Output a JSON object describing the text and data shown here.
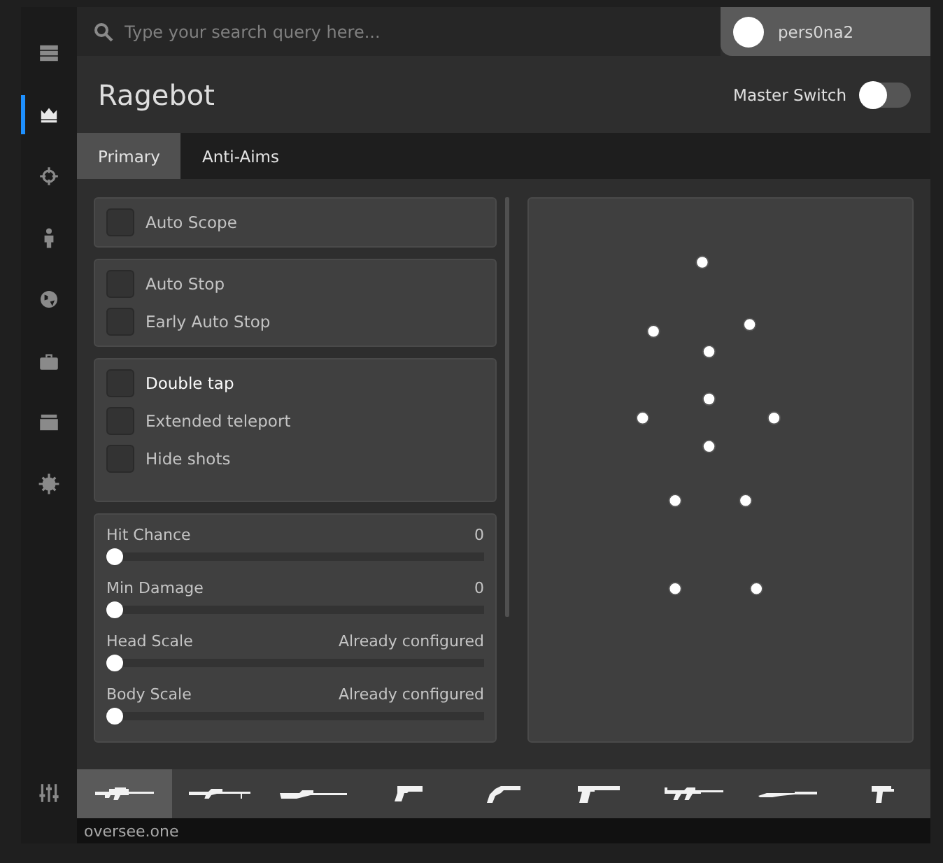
{
  "search": {
    "placeholder": "Type your search query here..."
  },
  "user": {
    "name": "pers0na2"
  },
  "sidebar": {
    "items": [
      {
        "kind": "server",
        "selected": false
      },
      {
        "kind": "crown",
        "selected": true
      },
      {
        "kind": "crosshair",
        "selected": false
      },
      {
        "kind": "person",
        "selected": false
      },
      {
        "kind": "globe",
        "selected": false
      },
      {
        "kind": "briefcase",
        "selected": false
      },
      {
        "kind": "box",
        "selected": false
      },
      {
        "kind": "gear",
        "selected": false
      }
    ],
    "bottom_item": {
      "kind": "sliders",
      "selected": false
    }
  },
  "page": {
    "title": "Ragebot",
    "master_switch": {
      "label": "Master Switch",
      "on": false
    }
  },
  "tabs": [
    {
      "label": "Primary",
      "selected": true
    },
    {
      "label": "Anti-Aims",
      "selected": false
    }
  ],
  "groups": [
    {
      "kind": "checkboxes",
      "items": [
        {
          "label": "Auto Scope",
          "checked": false,
          "highlighted": false
        }
      ]
    },
    {
      "kind": "checkboxes",
      "items": [
        {
          "label": "Auto Stop",
          "checked": false,
          "highlighted": false
        },
        {
          "label": "Early Auto Stop",
          "checked": false,
          "highlighted": false
        }
      ]
    },
    {
      "kind": "checkboxes",
      "items": [
        {
          "label": "Double tap",
          "checked": false,
          "highlighted": true
        },
        {
          "label": "Extended teleport",
          "checked": false,
          "highlighted": false
        },
        {
          "label": "Hide shots",
          "checked": false,
          "highlighted": false
        }
      ]
    },
    {
      "kind": "sliders",
      "items": [
        {
          "label": "Hit Chance",
          "reading": "0",
          "level": 0
        },
        {
          "label": "Min Damage",
          "reading": "0",
          "level": 0
        },
        {
          "label": "Head Scale",
          "reading": "Already configured",
          "level": 0
        },
        {
          "label": "Body Scale",
          "reading": "Already configured",
          "level": 0
        }
      ]
    }
  ],
  "weapons": [
    {
      "kind": "auto-sniper",
      "selected": true
    },
    {
      "kind": "scout",
      "selected": false
    },
    {
      "kind": "awp",
      "selected": false
    },
    {
      "kind": "pistol",
      "selected": false
    },
    {
      "kind": "revolver",
      "selected": false
    },
    {
      "kind": "heavy-pistol",
      "selected": false
    },
    {
      "kind": "rifle",
      "selected": false
    },
    {
      "kind": "shotgun",
      "selected": false
    },
    {
      "kind": "smg",
      "selected": false
    }
  ],
  "footer": {
    "text": "oversee.one"
  }
}
